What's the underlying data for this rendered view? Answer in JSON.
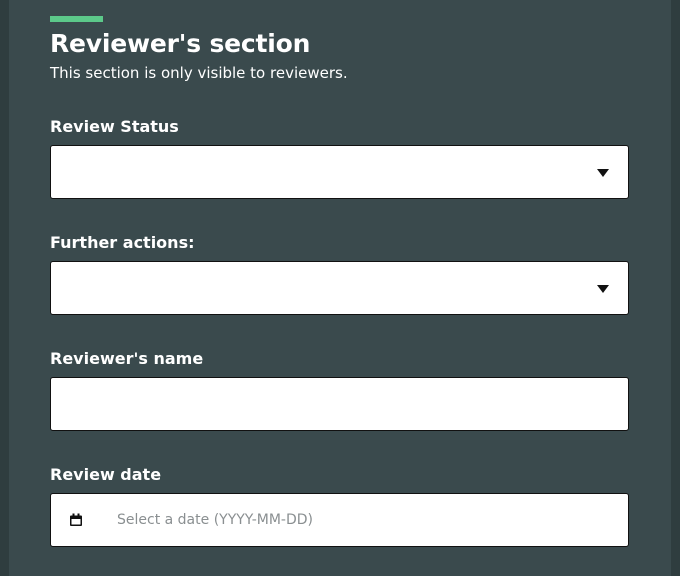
{
  "section": {
    "title": "Reviewer's section",
    "description": "This section is only visible to reviewers."
  },
  "fields": {
    "review_status": {
      "label": "Review Status",
      "value": ""
    },
    "further_actions": {
      "label": "Further actions:",
      "value": ""
    },
    "reviewer_name": {
      "label": "Reviewer's name",
      "value": ""
    },
    "review_date": {
      "label": "Review date",
      "placeholder": "Select a date (YYYY-MM-DD)"
    }
  },
  "colors": {
    "background": "#2f3d3f",
    "panel": "#3a4a4d",
    "accent": "#5cc98a",
    "field_bg": "#ffffff",
    "text": "#ffffff"
  },
  "icons": {
    "select_caret": "chevron-down-icon",
    "date": "calendar-icon"
  }
}
